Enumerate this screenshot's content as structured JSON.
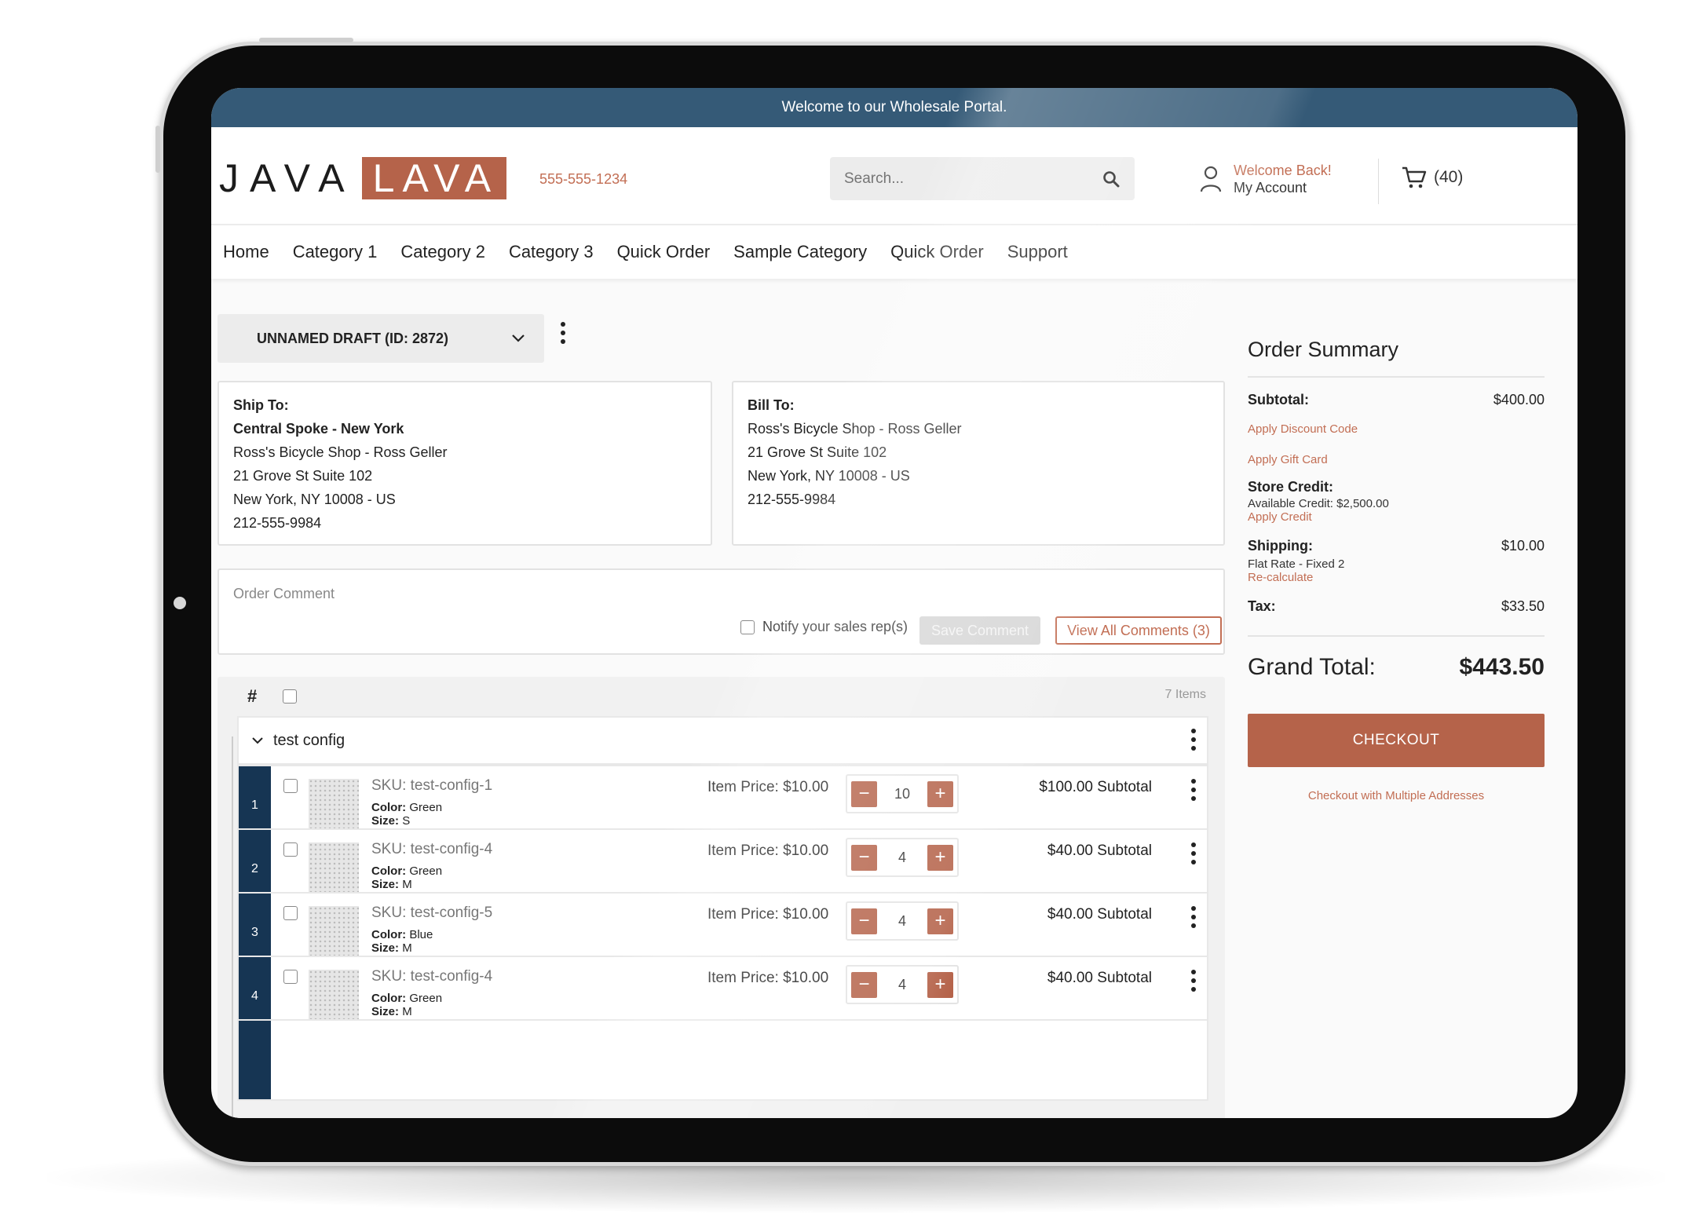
{
  "announcement": "Welcome to our Wholesale Portal.",
  "brand": {
    "java": "JAVA",
    "lava": "LAVA",
    "accent": "#b5634a",
    "primary": "#355a77"
  },
  "header": {
    "phone": "555-555-1234",
    "search_placeholder": "Search...",
    "welcome": "Welcome Back!",
    "account": "My Account",
    "cart_count": "(40)"
  },
  "nav": [
    "Home",
    "Category 1",
    "Category 2",
    "Category 3",
    "Quick Order",
    "Sample Category",
    "Quick Order",
    "Support"
  ],
  "draft": {
    "label": "UNNAMED DRAFT (ID: 2872)"
  },
  "ship_to": {
    "label": "Ship To:",
    "name": "Central Spoke - New York",
    "lines": [
      "Ross's Bicycle Shop - Ross Geller",
      "21 Grove St Suite 102",
      "New York, NY 10008 - US",
      "212-555-9984"
    ]
  },
  "bill_to": {
    "label": "Bill To:",
    "lines": [
      "Ross's Bicycle Shop - Ross Geller",
      "21 Grove St Suite 102",
      "New York, NY 10008 - US",
      "212-555-9984"
    ]
  },
  "comment": {
    "placeholder": "Order Comment",
    "notify": "Notify your sales rep(s)",
    "save": "Save Comment",
    "view_all": "View All Comments (3)"
  },
  "items_header": {
    "hash": "#",
    "count": "7 Items"
  },
  "group": {
    "name": "test config"
  },
  "items": [
    {
      "num": "1",
      "sku": "SKU: test-config-1",
      "color": "Green",
      "size": "S",
      "price": "Item Price: $10.00",
      "qty": "10",
      "subtotal": "$100.00 Subtotal"
    },
    {
      "num": "2",
      "sku": "SKU: test-config-4",
      "color": "Green",
      "size": "M",
      "price": "Item Price: $10.00",
      "qty": "4",
      "subtotal": "$40.00 Subtotal"
    },
    {
      "num": "3",
      "sku": "SKU: test-config-5",
      "color": "Blue",
      "size": "M",
      "price": "Item Price: $10.00",
      "qty": "4",
      "subtotal": "$40.00 Subtotal"
    },
    {
      "num": "4",
      "sku": "SKU: test-config-4",
      "color": "Green",
      "size": "M",
      "price": "Item Price: $10.00",
      "qty": "4",
      "subtotal": "$40.00 Subtotal"
    }
  ],
  "attr_labels": {
    "color": "Color:",
    "size": "Size:"
  },
  "summary": {
    "title": "Order Summary",
    "subtotal_label": "Subtotal:",
    "subtotal": "$400.00",
    "discount_link": "Apply Discount Code",
    "gift_link": "Apply Gift Card",
    "store_credit_label": "Store Credit:",
    "available_credit": "Available Credit: $2,500.00",
    "apply_credit": "Apply Credit",
    "shipping_label": "Shipping:",
    "shipping": "$10.00",
    "shipping_method": "Flat Rate - Fixed 2",
    "recalc": "Re-calculate",
    "tax_label": "Tax:",
    "tax": "$33.50",
    "grand_label": "Grand Total:",
    "grand": "$443.50",
    "checkout": "CHECKOUT",
    "multi": "Checkout with Multiple Addresses"
  }
}
